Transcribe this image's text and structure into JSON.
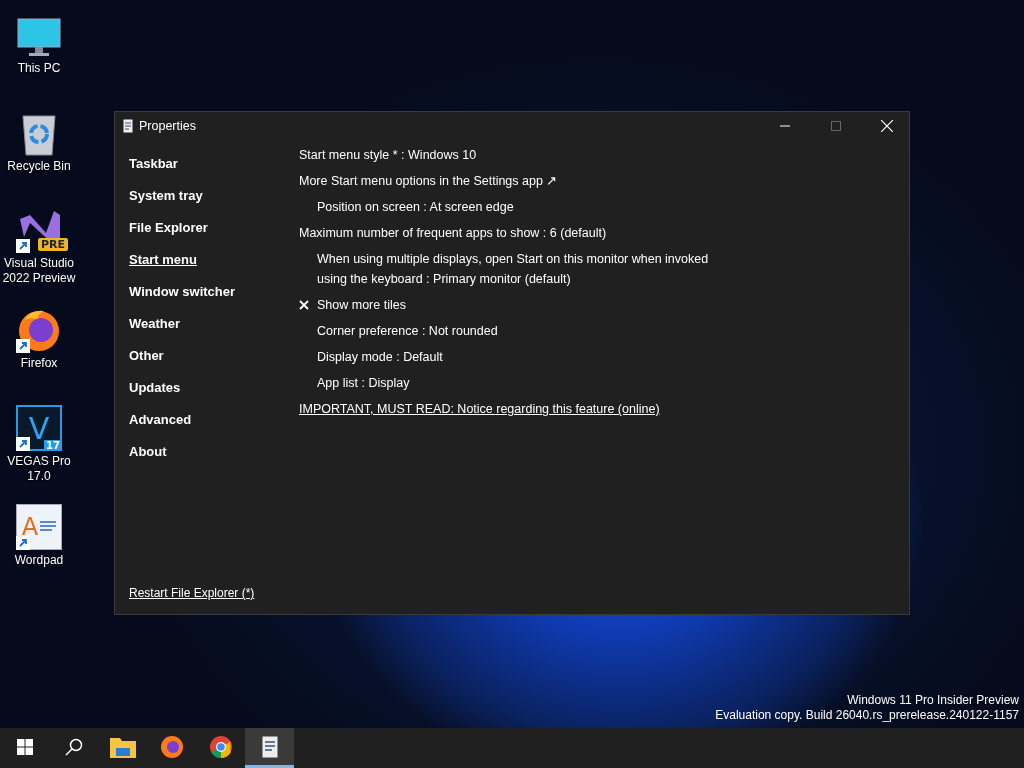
{
  "desktop_icons": [
    {
      "label": "This PC",
      "kind": "monitor",
      "shortcut": false
    },
    {
      "label": "Recycle Bin",
      "kind": "bin",
      "shortcut": false
    },
    {
      "label": "Visual Studio\n2022 Preview",
      "kind": "vs",
      "shortcut": true,
      "badge": "PRE"
    },
    {
      "label": "Firefox",
      "kind": "firefox",
      "shortcut": true
    },
    {
      "label": "VEGAS Pro\n17.0",
      "kind": "vegas",
      "shortcut": true,
      "glyph": "V",
      "badge": "17"
    },
    {
      "label": "Wordpad",
      "kind": "wordpad",
      "shortcut": true,
      "glyph": "A"
    }
  ],
  "window": {
    "title": "Properties",
    "sidebar": {
      "items": [
        {
          "label": "Taskbar",
          "selected": false
        },
        {
          "label": "System tray",
          "selected": false
        },
        {
          "label": "File Explorer",
          "selected": false
        },
        {
          "label": "Start menu",
          "selected": true
        },
        {
          "label": "Window switcher",
          "selected": false
        },
        {
          "label": "Weather",
          "selected": false
        },
        {
          "label": "Other",
          "selected": false
        },
        {
          "label": "Updates",
          "selected": false
        },
        {
          "label": "Advanced",
          "selected": false
        },
        {
          "label": "About",
          "selected": false
        }
      ],
      "footer_link": "Restart File Explorer (*)"
    },
    "settings": [
      {
        "kind": "option",
        "text": "Start menu style * : Windows 10"
      },
      {
        "kind": "link",
        "text": "More Start menu options in the Settings app ↗"
      },
      {
        "kind": "sub-option",
        "text": "Position on screen : At screen edge"
      },
      {
        "kind": "option",
        "text": "Maximum number of frequent apps to show : 6 (default)"
      },
      {
        "kind": "sub-option",
        "text": "When using multiple displays, open Start on this monitor when invoked using the keyboard : Primary monitor (default)"
      },
      {
        "kind": "check",
        "text": "Show more tiles",
        "checked": true
      },
      {
        "kind": "sub-option",
        "text": "Corner preference : Not rounded"
      },
      {
        "kind": "sub-option",
        "text": "Display mode : Default"
      },
      {
        "kind": "sub-option",
        "text": "App list : Display"
      },
      {
        "kind": "notice",
        "text": "IMPORTANT, MUST READ: Notice regarding this feature (online)"
      }
    ]
  },
  "watermark_os": [
    "Windows 11 Pro Insider Preview",
    "Evaluation copy. Build 26040.rs_prerelease.240122-1157"
  ],
  "taskbar": {
    "items": [
      {
        "kind": "start",
        "selected": false
      },
      {
        "kind": "search",
        "selected": false
      },
      {
        "kind": "folder",
        "selected": false
      },
      {
        "kind": "firefox",
        "selected": false
      },
      {
        "kind": "chrome",
        "selected": false
      },
      {
        "kind": "properties",
        "selected": true
      }
    ]
  }
}
